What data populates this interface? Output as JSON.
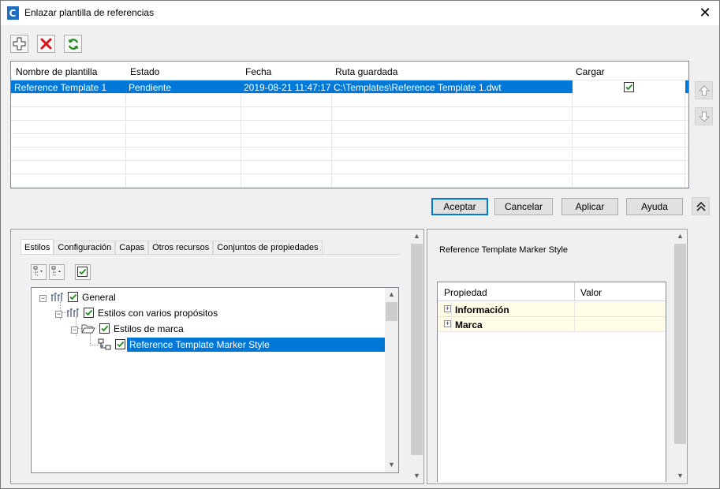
{
  "window": {
    "title": "Enlazar plantilla de referencias",
    "close_glyph": "✕"
  },
  "toolbar": {
    "add_icon": "plus-icon",
    "remove_icon": "red-x-icon",
    "refresh_icon": "refresh-icon"
  },
  "grid": {
    "columns": [
      "Nombre de plantilla",
      "Estado",
      "Fecha",
      "Ruta guardada",
      "Cargar"
    ],
    "rows": [
      {
        "name": "Reference Template 1",
        "status": "Pendiente",
        "date": "2019-08-21 11:47:17",
        "path": "C:\\Templates\\Reference Template 1.dwt",
        "load": true
      }
    ]
  },
  "buttons": {
    "ok": "Aceptar",
    "cancel": "Cancelar",
    "apply": "Aplicar",
    "help": "Ayuda"
  },
  "tabs": [
    "Estilos",
    "Configuración",
    "Capas",
    "Otros recursos",
    "Conjuntos de propiedades"
  ],
  "tree": {
    "root": "General",
    "child": "Estilos con varios propósitos",
    "grandchild": "Estilos de marca",
    "leaf": "Reference Template Marker Style"
  },
  "properties": {
    "title": "Reference Template Marker Style",
    "col_property": "Propiedad",
    "col_value": "Valor",
    "rows": [
      "Información",
      "Marca"
    ]
  },
  "colors": {
    "selection": "#0078d7",
    "accent_green": "#1a8a1a",
    "accent_red": "#d8141b"
  }
}
